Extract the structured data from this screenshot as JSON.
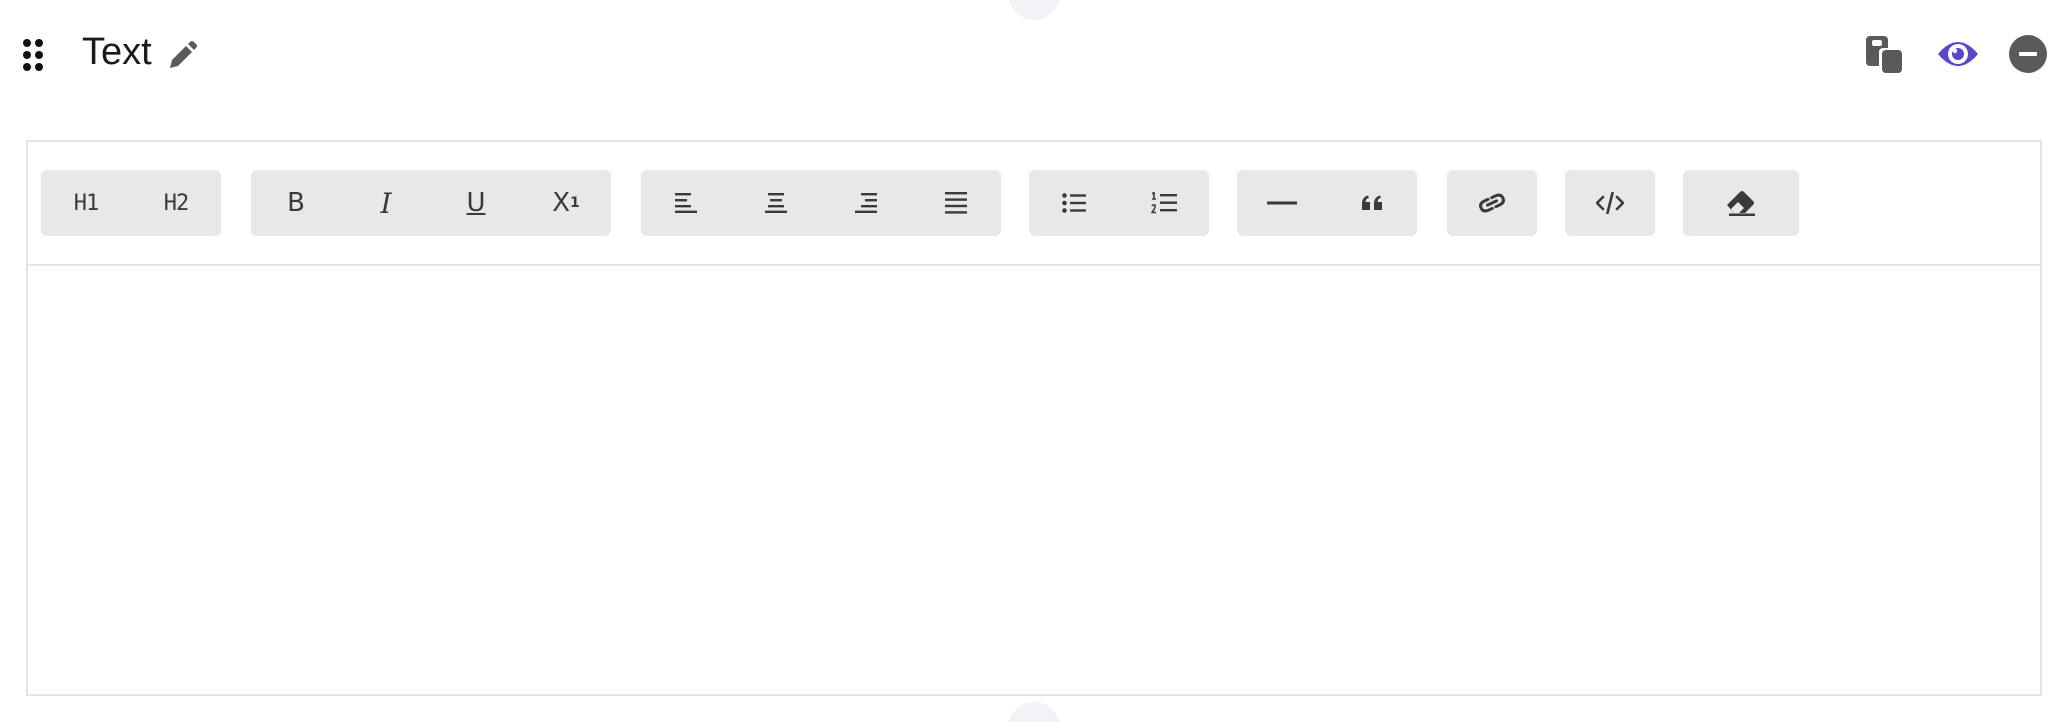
{
  "block": {
    "title": "Text"
  },
  "header_icons": {
    "drag": "drag-handle-icon",
    "edit": "pencil-icon",
    "copy": "copy-icon",
    "view": "eye-icon",
    "remove": "minus-circle-icon"
  },
  "toolbar": {
    "heading": {
      "h1_label": "H1",
      "h2_label": "H2"
    },
    "format": {
      "bold_label": "B",
      "italic_label": "I",
      "underline_label": "U",
      "superscript_label": "X",
      "superscript_sup": "1"
    },
    "align": [
      "align-left-icon",
      "align-center-icon",
      "align-right-icon",
      "align-justify-icon"
    ],
    "lists": [
      "bullet-list-icon",
      "numbered-list-icon"
    ],
    "blocks": [
      "horizontal-rule-icon",
      "quote-icon"
    ],
    "link": "link-icon",
    "code": "code-icon",
    "clear": "eraser-icon"
  },
  "editor": {
    "content": ""
  },
  "colors": {
    "accent": "#5b45c9",
    "toolbar_bg": "#e8e8ea",
    "border": "#e3e3e3",
    "icon": "#3a3a3a",
    "header_icon": "#5a5a5a"
  }
}
